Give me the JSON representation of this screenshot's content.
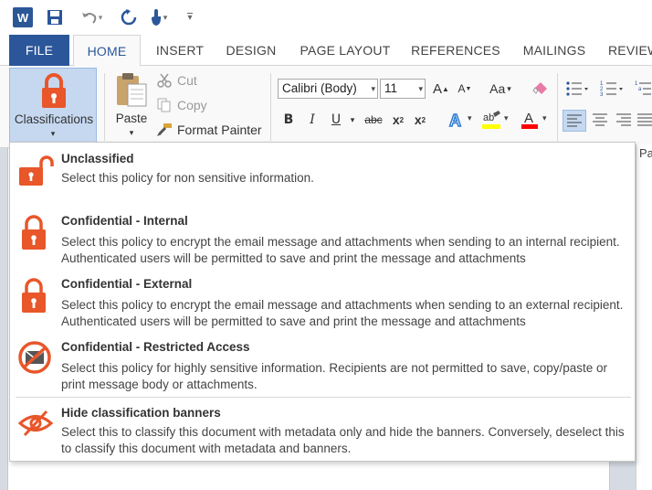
{
  "qat": {
    "app_letter": "W",
    "undo_caret": "▾",
    "customize_caret": "▾"
  },
  "tabs": {
    "file": "FILE",
    "home": "HOME",
    "insert": "INSERT",
    "design": "DESIGN",
    "page_layout": "PAGE LAYOUT",
    "references": "REFERENCES",
    "mailings": "MAILINGS",
    "review": "REVIEW"
  },
  "ribbon": {
    "classifications_label": "Classifications",
    "paste_label": "Paste",
    "cut_label": "Cut",
    "copy_label": "Copy",
    "format_painter_label": "Format Painter",
    "font_name": "Calibri (Body)",
    "font_size": "11",
    "grow_font": "A",
    "shrink_font": "A",
    "change_case": "Aa",
    "bold": "B",
    "italic": "I",
    "underline": "U",
    "strikethrough": "abc",
    "subscript": "x",
    "subscript_mark": "2",
    "superscript": "x",
    "superscript_mark": "2",
    "dropdown_caret": "▾"
  },
  "right_pane_tab": "Pa",
  "colors": {
    "accent_blue": "#2b579a",
    "lock_orange": "#e8562a",
    "selected_fill": "#c5d8f0",
    "highlight_yellow": "#ffff00",
    "font_color_red": "#ff0000"
  },
  "menu": {
    "items": [
      {
        "icon": "unlocked-padlock-icon",
        "title": "Unclassified",
        "description": "Select this policy for non sensitive information."
      },
      {
        "icon": "locked-padlock-icon",
        "title": "Confidential - Internal",
        "description": "Select this policy to encrypt the email message and attachments when sending to an internal recipient.  Authenticated users will be permitted to save and print the message and attachments"
      },
      {
        "icon": "locked-padlock-icon",
        "title": "Confidential - External",
        "description": "Select this policy to encrypt the email message and attachments when sending to an external recipient.  Authenticated users will be permitted to save and print the message and attachments"
      },
      {
        "icon": "restricted-envelope-icon",
        "title": "Confidential - Restricted Access",
        "description": "Select this policy for highly sensitive information. Recipients are not permitted to save, copy/paste or print message body or attachments."
      },
      {
        "icon": "hidden-eye-icon",
        "title": "Hide classification banners",
        "description": "Select this to classify this document with metadata only and hide the banners. Conversely, deselect this to classify this document with metadata and banners."
      }
    ]
  }
}
